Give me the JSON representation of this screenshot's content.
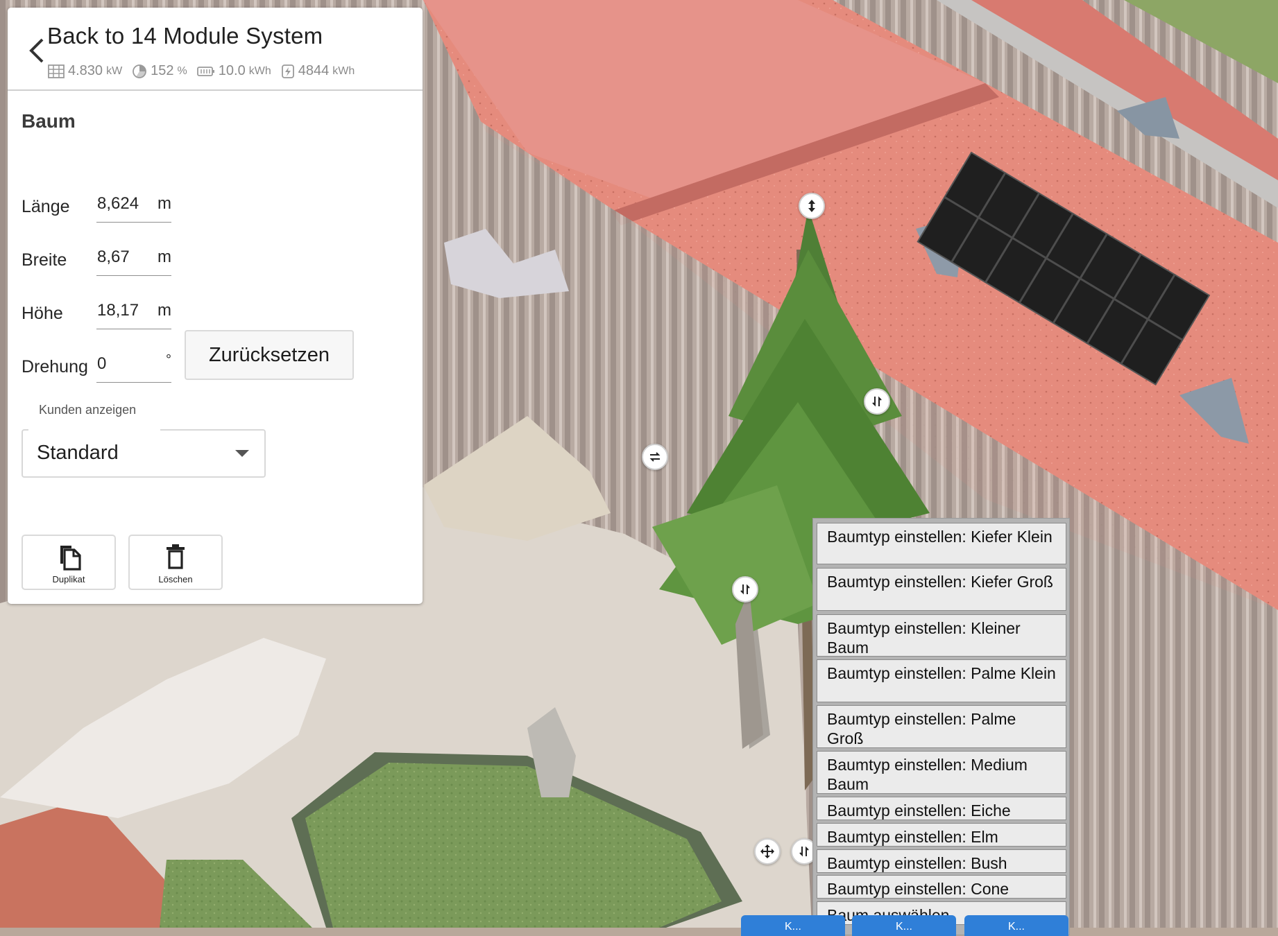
{
  "header": {
    "back_label": "Back to 14 Module System",
    "stats": [
      {
        "icon": "solar-panel-icon",
        "value": "4.830",
        "unit": "kW"
      },
      {
        "icon": "self-consumption-icon",
        "value": "152",
        "unit": "%"
      },
      {
        "icon": "battery-icon",
        "value": "10.0",
        "unit": "kWh"
      },
      {
        "icon": "energy-production-icon",
        "value": "4844",
        "unit": "kWh"
      }
    ]
  },
  "object": {
    "title": "Baum",
    "fields": [
      {
        "label": "Länge",
        "value": "8,624",
        "unit": "m"
      },
      {
        "label": "Breite",
        "value": "8,67",
        "unit": "m"
      },
      {
        "label": "Höhe",
        "value": "18,17",
        "unit": "m"
      },
      {
        "label": "Drehung",
        "value": "0",
        "unit": "°"
      }
    ],
    "reset_label": "Zurücksetzen",
    "customer_label": "Kunden anzeigen",
    "customer_select_value": "Standard",
    "actions": [
      {
        "label": "Duplikat",
        "icon": "duplicate-icon"
      },
      {
        "label": "Löschen",
        "icon": "trash-icon"
      }
    ]
  },
  "context_menu": {
    "items": [
      "Baumtyp einstellen: Kiefer Klein",
      "Baumtyp einstellen: Kiefer Groß",
      "Baumtyp einstellen: Kleiner Baum",
      "Baumtyp einstellen: Palme Klein",
      "Baumtyp einstellen: Palme Groß",
      "Baumtyp einstellen: Medium Baum",
      "Baumtyp einstellen: Eiche",
      "Baumtyp einstellen: Elm",
      "Baumtyp einstellen: Bush",
      "Baumtyp einstellen: Cone",
      "Baum auswählen"
    ]
  },
  "gizmos": {
    "height_handle": "vertical-arrows-icon",
    "rotate_handles": "rotate-arrows-icon",
    "move_handle": "move-icon"
  },
  "bottom_buttons": [
    "K...",
    "K...",
    "K..."
  ],
  "colors": {
    "roof": "#e08a7c",
    "panel_accent": "#1f1f1f",
    "button_blue": "#2f7fd8"
  }
}
